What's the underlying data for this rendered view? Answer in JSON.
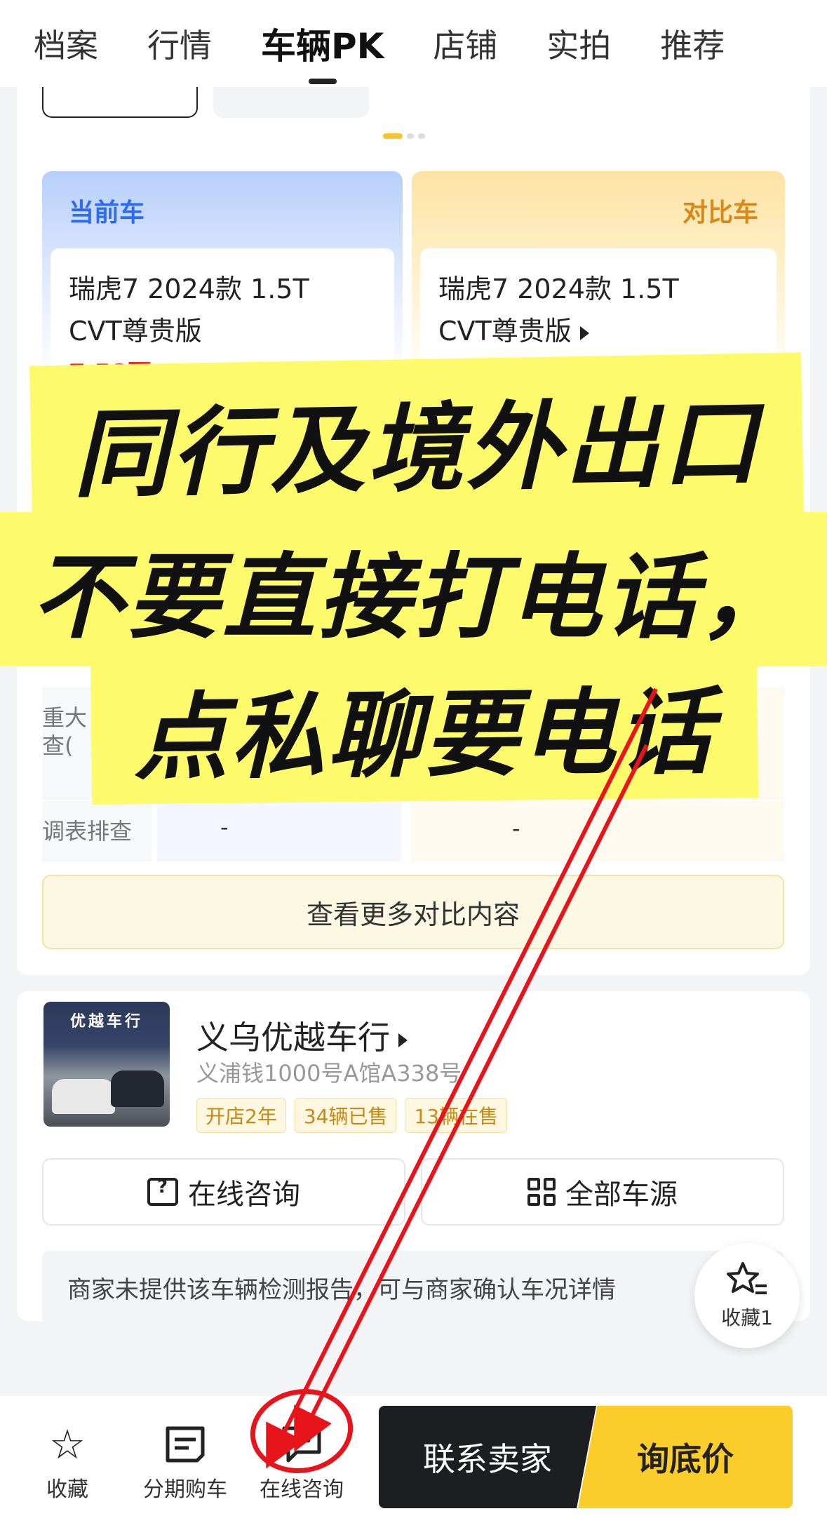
{
  "tabs": [
    {
      "label": "档案"
    },
    {
      "label": "行情"
    },
    {
      "label": "车辆PK"
    },
    {
      "label": "店铺"
    },
    {
      "label": "实拍"
    },
    {
      "label": "推荐"
    }
  ],
  "compare": {
    "current_label": "当前车",
    "compare_label": "对比车",
    "current_name_1": "瑞虎7 2024款 1.5T",
    "current_name_2": "CVT尊贵版",
    "current_price_peek": "7.58万",
    "compare_name_1": "瑞虎7 2024款 1.5T",
    "compare_name_2": "CVT尊贵版",
    "rows": [
      {
        "label_1": "重大",
        "label_2": "查(",
        "cur": "",
        "cmp": ""
      },
      {
        "label_1": "调表排查",
        "label_2": "",
        "cur": "-",
        "cmp": "-"
      }
    ],
    "more_label": "查看更多对比内容"
  },
  "overlay": {
    "line1": "同行及境外出口",
    "line2": "不要直接打电话，",
    "line3": "点私聊要电话"
  },
  "store": {
    "sign": "优越车行",
    "name": "义乌优越车行",
    "address": "义浦钱1000号A馆A338号",
    "badges": [
      "开店2年",
      "34辆已售",
      "13辆在售"
    ],
    "consult_label": "在线咨询",
    "all_cars_label": "全部车源",
    "notice": "商家未提供该车辆检测报告，可与商家确认车况详情"
  },
  "floating_fav": {
    "label": "收藏1",
    "icon": "star-list-icon"
  },
  "bottom": {
    "fav_label": "收藏",
    "installment_label": "分期购车",
    "chat_label": "在线咨询",
    "contact_label": "联系卖家",
    "price_label": "询底价"
  },
  "colors": {
    "accent_yellow": "#fbcd2b",
    "banner_yellow": "#fdfb6c",
    "annotation_red": "#e8141b",
    "current_blue": "#2f6bf0",
    "compare_orange": "#d9891a"
  }
}
